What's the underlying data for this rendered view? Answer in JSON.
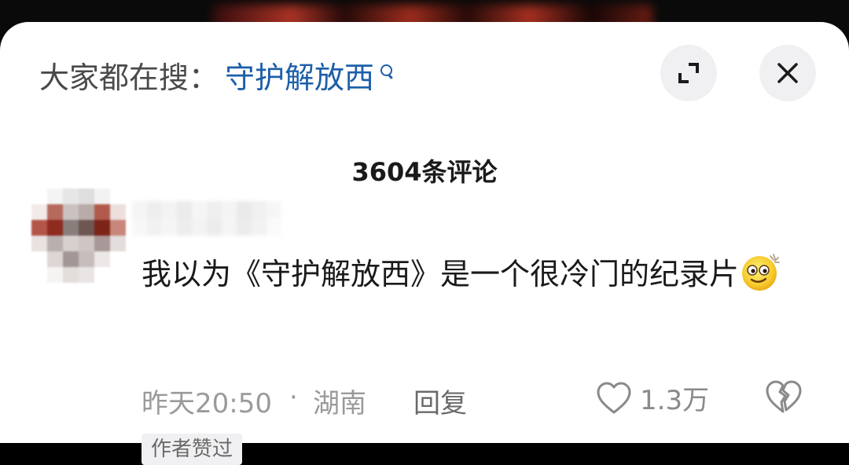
{
  "search_hint": {
    "prefix": "大家都在搜：",
    "term": "守护解放西",
    "icon": "search-icon"
  },
  "header_buttons": {
    "expand_icon": "expand-icon",
    "close_icon": "close-icon"
  },
  "comments_header": {
    "count_label": "3604条评论"
  },
  "comment": {
    "text": "我以为《守护解放西》是一个很冷门的纪录片",
    "emoji": "dizzy-smiley-emoji",
    "time": "昨天20:50",
    "separator": "·",
    "location": "湖南",
    "reply_label": "回复",
    "like_count": "1.3万",
    "author_liked_label": "作者赞过"
  },
  "colors": {
    "link_blue": "#1c5fa8",
    "text_primary": "#1a1a1a",
    "text_secondary": "#9a9a9a",
    "button_bg": "#f0f0f2"
  }
}
